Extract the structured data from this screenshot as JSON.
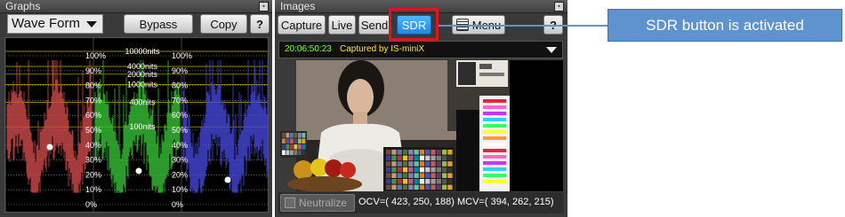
{
  "graphs": {
    "title": "Graphs",
    "waveform_select": "Wave Form",
    "bypass_label": "Bypass",
    "copy_label": "Copy",
    "help_label": "?",
    "scale_left": [
      "100%",
      "90%",
      "80%",
      "70%",
      "60%",
      "50%",
      "40%",
      "30%",
      "20%",
      "10%",
      "0%"
    ],
    "scale_mid": [
      "100%",
      "90%",
      "80%",
      "70%",
      "60%",
      "50%",
      "40%",
      "30%",
      "20%",
      "10%",
      "0%"
    ],
    "nits": [
      "10000nits",
      "4000nits",
      "2000nits",
      "1000nits",
      "400nits",
      "100nits"
    ],
    "colors": {
      "red": "#d04a4a",
      "green": "#36c036",
      "blue": "#4646d8",
      "nits_line": "#c8b400"
    }
  },
  "images": {
    "title": "Images",
    "capture_label": "Capture",
    "live_label": "Live",
    "send_label": "Send",
    "sdr_label": "SDR",
    "menu_label": "Menu",
    "help_label": "?",
    "timestamp": "20:06:50:23",
    "captured_by": "Captured by IS-miniX",
    "neutralize_label": "Neutralize",
    "ocv_mcv": "OCV=( 423, 250, 188) MCV=( 394, 262, 215)",
    "accent": "#1e8ae6"
  },
  "annotation": {
    "callout_text": "SDR button is activated",
    "highlight_color": "#e0141e",
    "callout_color": "#5e93cf"
  }
}
